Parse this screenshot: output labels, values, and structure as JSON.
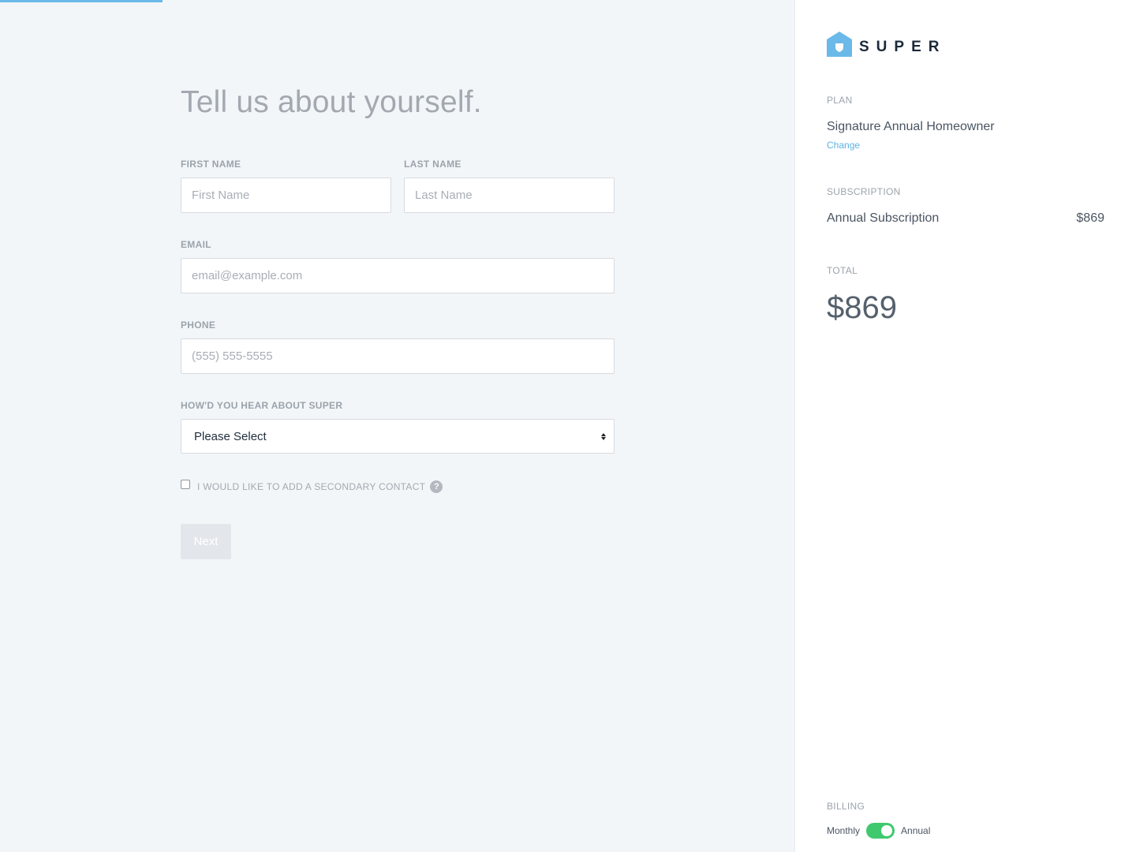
{
  "progress": {
    "value": 0.143,
    "color": "#6bb9e8"
  },
  "form": {
    "title": "Tell us about yourself.",
    "first_name": {
      "label": "FIRST NAME",
      "placeholder": "First Name",
      "value": ""
    },
    "last_name": {
      "label": "LAST NAME",
      "placeholder": "Last Name",
      "value": ""
    },
    "email": {
      "label": "EMAIL",
      "placeholder": "email@example.com",
      "value": ""
    },
    "phone": {
      "label": "PHONE",
      "placeholder": "(555) 555-5555",
      "value": ""
    },
    "referral": {
      "label": "HOW'D YOU HEAR ABOUT SUPER",
      "selected": "Please Select"
    },
    "secondary_contact": {
      "label": "I WOULD LIKE TO ADD A SECONDARY CONTACT",
      "checked": false,
      "help_icon": "?"
    },
    "next_label": "Next"
  },
  "sidebar": {
    "brand": "SUPER",
    "plan_label": "PLAN",
    "plan_name": "Signature Annual Homeowner",
    "change_link": "Change",
    "subscription_label": "SUBSCRIPTION",
    "subscription_name": "Annual Subscription",
    "subscription_price": "$869",
    "total_label": "TOTAL",
    "total_value": "$869",
    "billing_label": "BILLING",
    "billing_monthly": "Monthly",
    "billing_annual": "Annual",
    "billing_selected": "Annual"
  },
  "colors": {
    "accent": "#6bb9e8",
    "toggle_on": "#3fc96e",
    "link": "#5bb3e0"
  }
}
